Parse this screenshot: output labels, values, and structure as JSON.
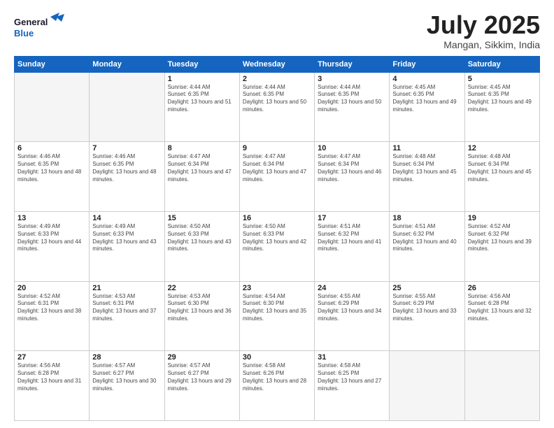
{
  "header": {
    "logo_general": "General",
    "logo_blue": "Blue",
    "month_title": "July 2025",
    "location": "Mangan, Sikkim, India"
  },
  "days_of_week": [
    "Sunday",
    "Monday",
    "Tuesday",
    "Wednesday",
    "Thursday",
    "Friday",
    "Saturday"
  ],
  "weeks": [
    [
      {
        "day": "",
        "info": ""
      },
      {
        "day": "",
        "info": ""
      },
      {
        "day": "1",
        "info": "Sunrise: 4:44 AM\nSunset: 6:35 PM\nDaylight: 13 hours and 51 minutes."
      },
      {
        "day": "2",
        "info": "Sunrise: 4:44 AM\nSunset: 6:35 PM\nDaylight: 13 hours and 50 minutes."
      },
      {
        "day": "3",
        "info": "Sunrise: 4:44 AM\nSunset: 6:35 PM\nDaylight: 13 hours and 50 minutes."
      },
      {
        "day": "4",
        "info": "Sunrise: 4:45 AM\nSunset: 6:35 PM\nDaylight: 13 hours and 49 minutes."
      },
      {
        "day": "5",
        "info": "Sunrise: 4:45 AM\nSunset: 6:35 PM\nDaylight: 13 hours and 49 minutes."
      }
    ],
    [
      {
        "day": "6",
        "info": "Sunrise: 4:46 AM\nSunset: 6:35 PM\nDaylight: 13 hours and 48 minutes."
      },
      {
        "day": "7",
        "info": "Sunrise: 4:46 AM\nSunset: 6:35 PM\nDaylight: 13 hours and 48 minutes."
      },
      {
        "day": "8",
        "info": "Sunrise: 4:47 AM\nSunset: 6:34 PM\nDaylight: 13 hours and 47 minutes."
      },
      {
        "day": "9",
        "info": "Sunrise: 4:47 AM\nSunset: 6:34 PM\nDaylight: 13 hours and 47 minutes."
      },
      {
        "day": "10",
        "info": "Sunrise: 4:47 AM\nSunset: 6:34 PM\nDaylight: 13 hours and 46 minutes."
      },
      {
        "day": "11",
        "info": "Sunrise: 4:48 AM\nSunset: 6:34 PM\nDaylight: 13 hours and 45 minutes."
      },
      {
        "day": "12",
        "info": "Sunrise: 4:48 AM\nSunset: 6:34 PM\nDaylight: 13 hours and 45 minutes."
      }
    ],
    [
      {
        "day": "13",
        "info": "Sunrise: 4:49 AM\nSunset: 6:33 PM\nDaylight: 13 hours and 44 minutes."
      },
      {
        "day": "14",
        "info": "Sunrise: 4:49 AM\nSunset: 6:33 PM\nDaylight: 13 hours and 43 minutes."
      },
      {
        "day": "15",
        "info": "Sunrise: 4:50 AM\nSunset: 6:33 PM\nDaylight: 13 hours and 43 minutes."
      },
      {
        "day": "16",
        "info": "Sunrise: 4:50 AM\nSunset: 6:33 PM\nDaylight: 13 hours and 42 minutes."
      },
      {
        "day": "17",
        "info": "Sunrise: 4:51 AM\nSunset: 6:32 PM\nDaylight: 13 hours and 41 minutes."
      },
      {
        "day": "18",
        "info": "Sunrise: 4:51 AM\nSunset: 6:32 PM\nDaylight: 13 hours and 40 minutes."
      },
      {
        "day": "19",
        "info": "Sunrise: 4:52 AM\nSunset: 6:32 PM\nDaylight: 13 hours and 39 minutes."
      }
    ],
    [
      {
        "day": "20",
        "info": "Sunrise: 4:52 AM\nSunset: 6:31 PM\nDaylight: 13 hours and 38 minutes."
      },
      {
        "day": "21",
        "info": "Sunrise: 4:53 AM\nSunset: 6:31 PM\nDaylight: 13 hours and 37 minutes."
      },
      {
        "day": "22",
        "info": "Sunrise: 4:53 AM\nSunset: 6:30 PM\nDaylight: 13 hours and 36 minutes."
      },
      {
        "day": "23",
        "info": "Sunrise: 4:54 AM\nSunset: 6:30 PM\nDaylight: 13 hours and 35 minutes."
      },
      {
        "day": "24",
        "info": "Sunrise: 4:55 AM\nSunset: 6:29 PM\nDaylight: 13 hours and 34 minutes."
      },
      {
        "day": "25",
        "info": "Sunrise: 4:55 AM\nSunset: 6:29 PM\nDaylight: 13 hours and 33 minutes."
      },
      {
        "day": "26",
        "info": "Sunrise: 4:56 AM\nSunset: 6:28 PM\nDaylight: 13 hours and 32 minutes."
      }
    ],
    [
      {
        "day": "27",
        "info": "Sunrise: 4:56 AM\nSunset: 6:28 PM\nDaylight: 13 hours and 31 minutes."
      },
      {
        "day": "28",
        "info": "Sunrise: 4:57 AM\nSunset: 6:27 PM\nDaylight: 13 hours and 30 minutes."
      },
      {
        "day": "29",
        "info": "Sunrise: 4:57 AM\nSunset: 6:27 PM\nDaylight: 13 hours and 29 minutes."
      },
      {
        "day": "30",
        "info": "Sunrise: 4:58 AM\nSunset: 6:26 PM\nDaylight: 13 hours and 28 minutes."
      },
      {
        "day": "31",
        "info": "Sunrise: 4:58 AM\nSunset: 6:25 PM\nDaylight: 13 hours and 27 minutes."
      },
      {
        "day": "",
        "info": ""
      },
      {
        "day": "",
        "info": ""
      }
    ]
  ]
}
